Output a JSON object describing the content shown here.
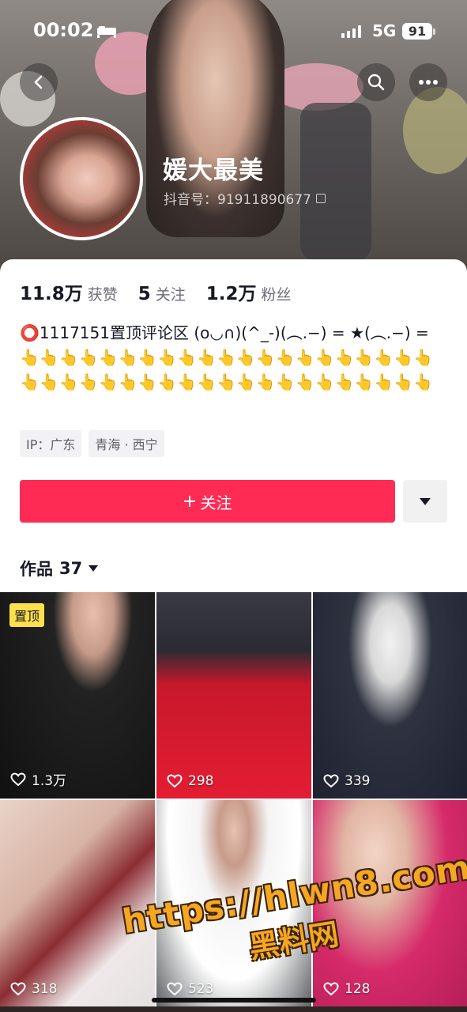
{
  "status_bar": {
    "time": "00:02",
    "network": "5G",
    "battery": "91"
  },
  "profile": {
    "name": "媛大最美",
    "douyin_id": "抖音号：91911890677"
  },
  "stats": [
    {
      "value": "11.8万",
      "label": "获赞"
    },
    {
      "value": "5",
      "label": "关注"
    },
    {
      "value": "1.2万",
      "label": "粉丝"
    }
  ],
  "bio": "⭕1117151置顶评论区 (o◡∩)(^_-)(︵.−) = ★(︵.−) = 👆👆👆👆👆👆👆👆👆👆👆👆👆👆👆👆👆👆👆👆👆👆👆👆👆👆👆👆👆👆👆👆👆👆👆👆👆👆👆👆👆👆",
  "tags": [
    "IP：广东",
    "青海 · 西宁"
  ],
  "follow_button": "关注",
  "works_tab": {
    "label": "作品",
    "count": "37"
  },
  "pinned_label": "置顶",
  "videos": [
    {
      "likes": "1.3万",
      "pinned": true
    },
    {
      "likes": "298"
    },
    {
      "likes": "339"
    },
    {
      "likes": "318"
    },
    {
      "likes": "523"
    },
    {
      "likes": "128"
    }
  ],
  "watermark": {
    "url": "https://hlwn8.com",
    "text": "黑料网"
  },
  "colors": {
    "accent": "#fe2c55",
    "pin": "#ffe04b",
    "watermark": "#f5a623"
  }
}
